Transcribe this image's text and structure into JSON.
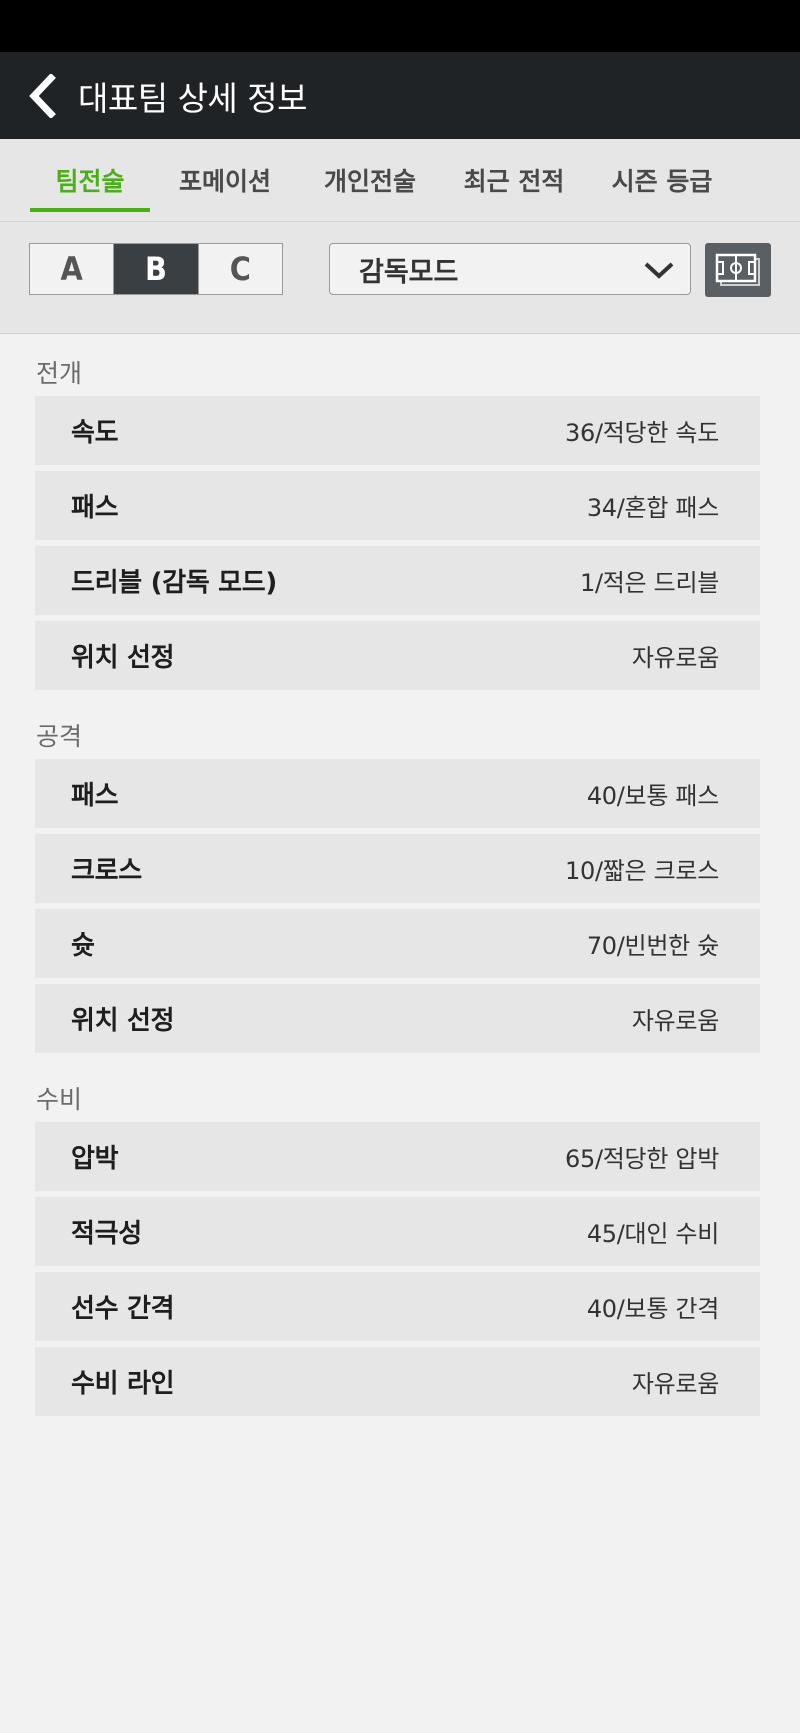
{
  "header": {
    "title": "대표팀 상세 정보"
  },
  "tabs": [
    {
      "label": "팀전술",
      "active": true
    },
    {
      "label": "포메이션",
      "active": false
    },
    {
      "label": "개인전술",
      "active": false
    },
    {
      "label": "최근 전적",
      "active": false
    },
    {
      "label": "시즌 등급",
      "active": false
    }
  ],
  "tactic_set": {
    "options": [
      "A",
      "B",
      "C"
    ],
    "selected": "B"
  },
  "mode_select": {
    "value": "감독모드"
  },
  "icons": {
    "back": "chevron-left-icon",
    "dropdown": "chevron-down-icon",
    "field": "soccer-field-icon"
  },
  "colors": {
    "accent": "#4caf1a",
    "header_bg": "#1f2326",
    "selected_seg": "#3a3f44"
  },
  "sections": [
    {
      "title": "전개",
      "rows": [
        {
          "label": "속도",
          "value": "36/적당한 속도"
        },
        {
          "label": "패스",
          "value": "34/혼합 패스"
        },
        {
          "label": "드리블 (감독 모드)",
          "value": "1/적은 드리블"
        },
        {
          "label": "위치 선정",
          "value": "자유로움"
        }
      ]
    },
    {
      "title": "공격",
      "rows": [
        {
          "label": "패스",
          "value": "40/보통 패스"
        },
        {
          "label": "크로스",
          "value": "10/짧은 크로스"
        },
        {
          "label": "슛",
          "value": "70/빈번한 슛"
        },
        {
          "label": "위치 선정",
          "value": "자유로움"
        }
      ]
    },
    {
      "title": "수비",
      "rows": [
        {
          "label": "압박",
          "value": "65/적당한 압박"
        },
        {
          "label": "적극성",
          "value": "45/대인 수비"
        },
        {
          "label": "선수 간격",
          "value": "40/보통 간격"
        },
        {
          "label": "수비 라인",
          "value": "자유로움"
        }
      ]
    }
  ]
}
